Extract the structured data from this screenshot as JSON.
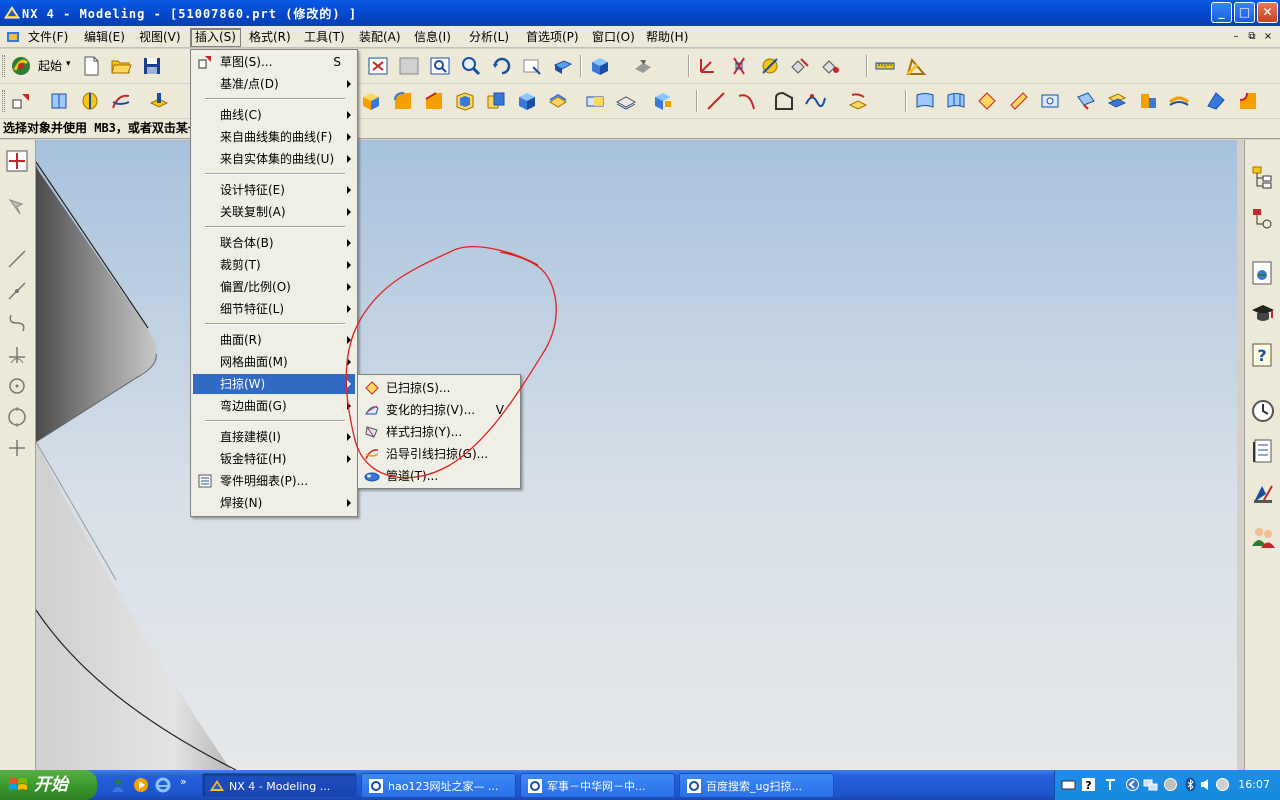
{
  "window": {
    "title": "NX 4 - Modeling - [51007860.prt  (修改的) ]",
    "buttons": {
      "minimize": "_",
      "maximize": "□",
      "close": "✕"
    }
  },
  "menubar": {
    "items": [
      {
        "label": "文件(F)"
      },
      {
        "label": "编辑(E)"
      },
      {
        "label": "视图(V)"
      },
      {
        "label": "插入(S)"
      },
      {
        "label": "格式(R)"
      },
      {
        "label": "工具(T)"
      },
      {
        "label": "装配(A)"
      },
      {
        "label": "信息(I)"
      },
      {
        "label": "分析(L)"
      },
      {
        "label": "首选项(P)"
      },
      {
        "label": "窗口(O)"
      },
      {
        "label": "帮助(H)"
      }
    ],
    "mdi_buttons": [
      "–",
      "⧉",
      "×"
    ]
  },
  "toolbar": {
    "start_label": "起始",
    "start_arrow": "▾"
  },
  "status": {
    "prompt": "选择对象并使用 MB3，或者双击某一对象"
  },
  "insert_menu": {
    "items": [
      {
        "label": "草图(S)...",
        "shortcut": "S"
      },
      {
        "label": "基准/点(D)"
      },
      {
        "label": "曲线(C)"
      },
      {
        "label": "来自曲线集的曲线(F)"
      },
      {
        "label": "来自实体集的曲线(U)"
      },
      {
        "label": "设计特征(E)"
      },
      {
        "label": "关联复制(A)"
      },
      {
        "label": "联合体(B)"
      },
      {
        "label": "裁剪(T)"
      },
      {
        "label": "偏置/比例(O)"
      },
      {
        "label": "细节特征(L)"
      },
      {
        "label": "曲面(R)"
      },
      {
        "label": "网格曲面(M)"
      },
      {
        "label": "扫掠(W)"
      },
      {
        "label": "弯边曲面(G)"
      },
      {
        "label": "直接建模(I)"
      },
      {
        "label": "钣金特征(H)"
      },
      {
        "label": "零件明细表(P)..."
      },
      {
        "label": "焊接(N)"
      }
    ]
  },
  "sweep_submenu": {
    "items": [
      {
        "label": "已扫掠(S)..."
      },
      {
        "label": "变化的扫掠(V)...",
        "shortcut": "V"
      },
      {
        "label": "样式扫掠(Y)..."
      },
      {
        "label": "沿导引线扫掠(G)..."
      },
      {
        "label": "管道(T)..."
      }
    ]
  },
  "taskbar": {
    "start_label": "开始",
    "quick_launch_more": "»",
    "tasks": [
      {
        "label": "NX 4 - Modeling ..."
      },
      {
        "label": "hao123网址之家— ..."
      },
      {
        "label": "军事－中华网－中..."
      },
      {
        "label": "百度搜索_ug扫掠..."
      }
    ],
    "clock": "16:07"
  },
  "colors": {
    "titlebar": "#0646c8",
    "menu_highlight": "#316ac5",
    "annotation": "#e02020",
    "viewport_top": "#a8c2dc",
    "viewport_bottom": "#e6e8ea"
  }
}
